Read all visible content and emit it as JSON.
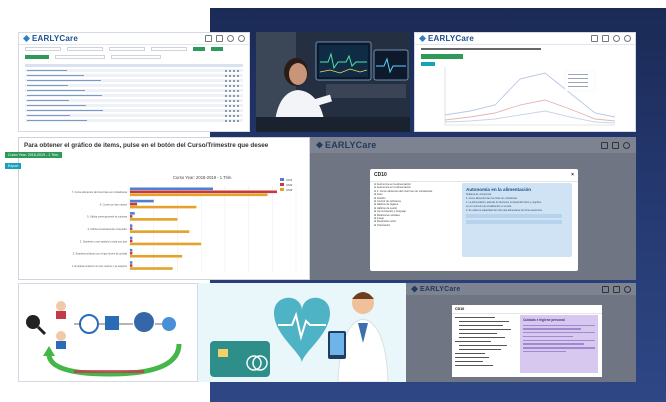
{
  "brand": {
    "name": "EARLYCare",
    "left_color": "#ffffff",
    "right_color_top": "#1b2a55",
    "right_color_bottom": "#2e4785"
  },
  "tile1": {
    "logo": "EARLYCare",
    "list_rows": 11
  },
  "tile3": {
    "logo": "EARLYCare"
  },
  "chart_panel": {
    "title": "Para obtener el gráfico de items, pulse en el botón del Curso/Trimestre que desee",
    "course_button": "Curso Year: 2018-2019 - 1 Trim.",
    "export_button": "Export"
  },
  "chart_data": {
    "type": "bar",
    "orientation": "horizontal",
    "title": "Curso Year: 2018-2019 - 1 Trim.",
    "categories": [
      "7. Come alimentos del nivel tras ser cortados/as",
      "6. Come con las manos",
      "5. Utiliza correctamente la cuchara",
      "4. Utiliza correctamente el tenedor",
      "3. Sostiene y usa vasito/a o taza con asa",
      "2. Empieza al lavar con el que sirven la comida",
      "1. Empieza al lavar con sus manos y se asignes"
    ],
    "series": [
      {
        "name": "CM1",
        "color": "#4f7fd1",
        "values": [
          35,
          10,
          2,
          1,
          1,
          1,
          1
        ]
      },
      {
        "name": "CM2",
        "color": "#c9383d",
        "values": [
          62,
          3,
          1,
          1,
          1,
          1,
          1
        ]
      },
      {
        "name": "CM3",
        "color": "#e3a22a",
        "values": [
          58,
          28,
          20,
          25,
          30,
          22,
          18
        ]
      }
    ],
    "xlim": [
      0,
      70
    ],
    "legend": "top-right"
  },
  "tile5": {
    "logo": "EARLYCare",
    "modal_title": "CD10",
    "tree": [
      "Autonomía en la alimentación",
      "Autonomía en la alimentación",
      "1. Come alimentos del nivel tras ser cortados/as",
      "Aseo",
      "Vestido",
      "Control de esfínteres",
      "Hábitos de higiene",
      "Hábitos de sueño",
      "Comunicación y lenguaje",
      "Relaciones sociales",
      "Juego",
      "Desarrollo motor",
      "Orientación"
    ],
    "card_title": "Autonomía en la alimentación",
    "card_lines": [
      "Subárea de: Autonomía",
      "1. Come alimentos del nivel tras ser cortados/as",
      "1. La alimentación, además de favorecer el desarrollo físico y cognitivo,",
      "es un momento de socialización en el aula.",
      "2. Se valora la capacidad del niño para alimentarse de forma autónoma."
    ]
  },
  "tile8": {
    "logo": "EARLYCare",
    "modal_title": "CD10",
    "card_title": "Cuidado e higiene personal"
  }
}
